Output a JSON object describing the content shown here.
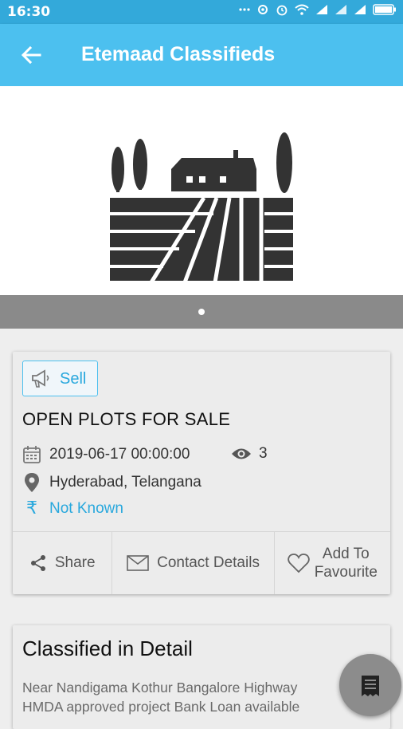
{
  "status_bar": {
    "time": "16:30",
    "battery_icon": "battery-icon",
    "signal_icons": [
      "signal-icon",
      "wifi-icon",
      "alarm-icon"
    ]
  },
  "app_bar": {
    "title": "Etemaad Classifieds"
  },
  "gallery": {
    "image": "farmland-icon",
    "page_count": 1,
    "active_page": 1
  },
  "listing": {
    "tag": "Sell",
    "title": "OPEN PLOTS FOR SALE",
    "date": "2019-06-17 00:00:00",
    "views": "3",
    "location": "Hyderabad, Telangana",
    "price": "Not Known",
    "price_color": "#29a8dd"
  },
  "actions": {
    "share": "Share",
    "contact": "Contact Details",
    "favourite_line1": "Add To",
    "favourite_line2": "Favourite"
  },
  "detail": {
    "heading": "Classified in Detail",
    "line1": "Near Nandigama Kothur Bangalore Highway",
    "line2": "HMDA approved project Bank Loan available"
  },
  "colors": {
    "accent": "#4cc0ef",
    "status_bar": "#33a9da"
  }
}
